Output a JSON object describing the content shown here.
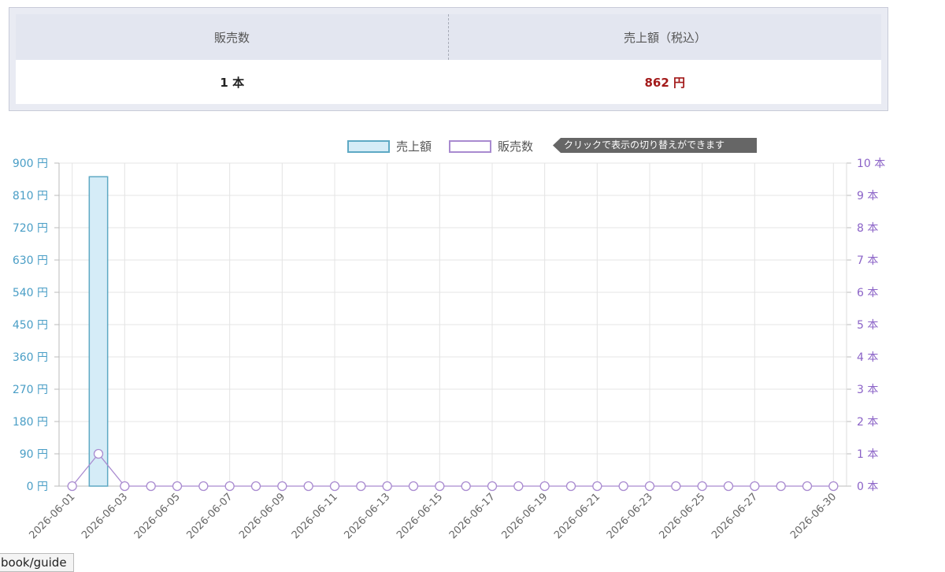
{
  "summary": {
    "headers": [
      "販売数",
      "売上額（税込）"
    ],
    "values": [
      "1 本",
      "862 円"
    ]
  },
  "legend": {
    "sales_label": "売上額",
    "qty_label": "販売数",
    "hint": "クリックで表示の切り替えができます"
  },
  "tooltip_text": "book/guide",
  "colors": {
    "sales_fill": "#d5ecf7",
    "sales_stroke": "#5ea9c4",
    "qty_stroke": "#a98bd0",
    "left_axis_text": "#4a9ec6",
    "right_axis_text": "#8b63c7",
    "amount_text": "#a31a1a"
  },
  "chart_data": {
    "type": "bar",
    "categories": [
      "2026-06-01",
      "2026-06-02",
      "2026-06-03",
      "2026-06-04",
      "2026-06-05",
      "2026-06-06",
      "2026-06-07",
      "2026-06-08",
      "2026-06-09",
      "2026-06-10",
      "2026-06-11",
      "2026-06-12",
      "2026-06-13",
      "2026-06-14",
      "2026-06-15",
      "2026-06-16",
      "2026-06-17",
      "2026-06-18",
      "2026-06-19",
      "2026-06-20",
      "2026-06-21",
      "2026-06-22",
      "2026-06-23",
      "2026-06-24",
      "2026-06-25",
      "2026-06-26",
      "2026-06-27",
      "2026-06-28",
      "2026-06-29",
      "2026-06-30"
    ],
    "x_tick_labels": [
      "2026-06-01",
      "2026-06-03",
      "2026-06-05",
      "2026-06-07",
      "2026-06-09",
      "2026-06-11",
      "2026-06-13",
      "2026-06-15",
      "2026-06-17",
      "2026-06-19",
      "2026-06-21",
      "2026-06-23",
      "2026-06-25",
      "2026-06-27",
      "2026-06-30"
    ],
    "series": [
      {
        "name": "売上額",
        "type": "bar",
        "axis": "left",
        "values": [
          0,
          862,
          0,
          0,
          0,
          0,
          0,
          0,
          0,
          0,
          0,
          0,
          0,
          0,
          0,
          0,
          0,
          0,
          0,
          0,
          0,
          0,
          0,
          0,
          0,
          0,
          0,
          0,
          0,
          0
        ]
      },
      {
        "name": "販売数",
        "type": "line",
        "axis": "right",
        "values": [
          0,
          1,
          0,
          0,
          0,
          0,
          0,
          0,
          0,
          0,
          0,
          0,
          0,
          0,
          0,
          0,
          0,
          0,
          0,
          0,
          0,
          0,
          0,
          0,
          0,
          0,
          0,
          0,
          0,
          0
        ]
      }
    ],
    "y_left": {
      "min": 0,
      "max": 900,
      "step": 90,
      "unit": "円"
    },
    "y_right": {
      "min": 0,
      "max": 10,
      "step": 1,
      "unit": "本"
    },
    "grid": true,
    "legend_position": "top-center"
  }
}
